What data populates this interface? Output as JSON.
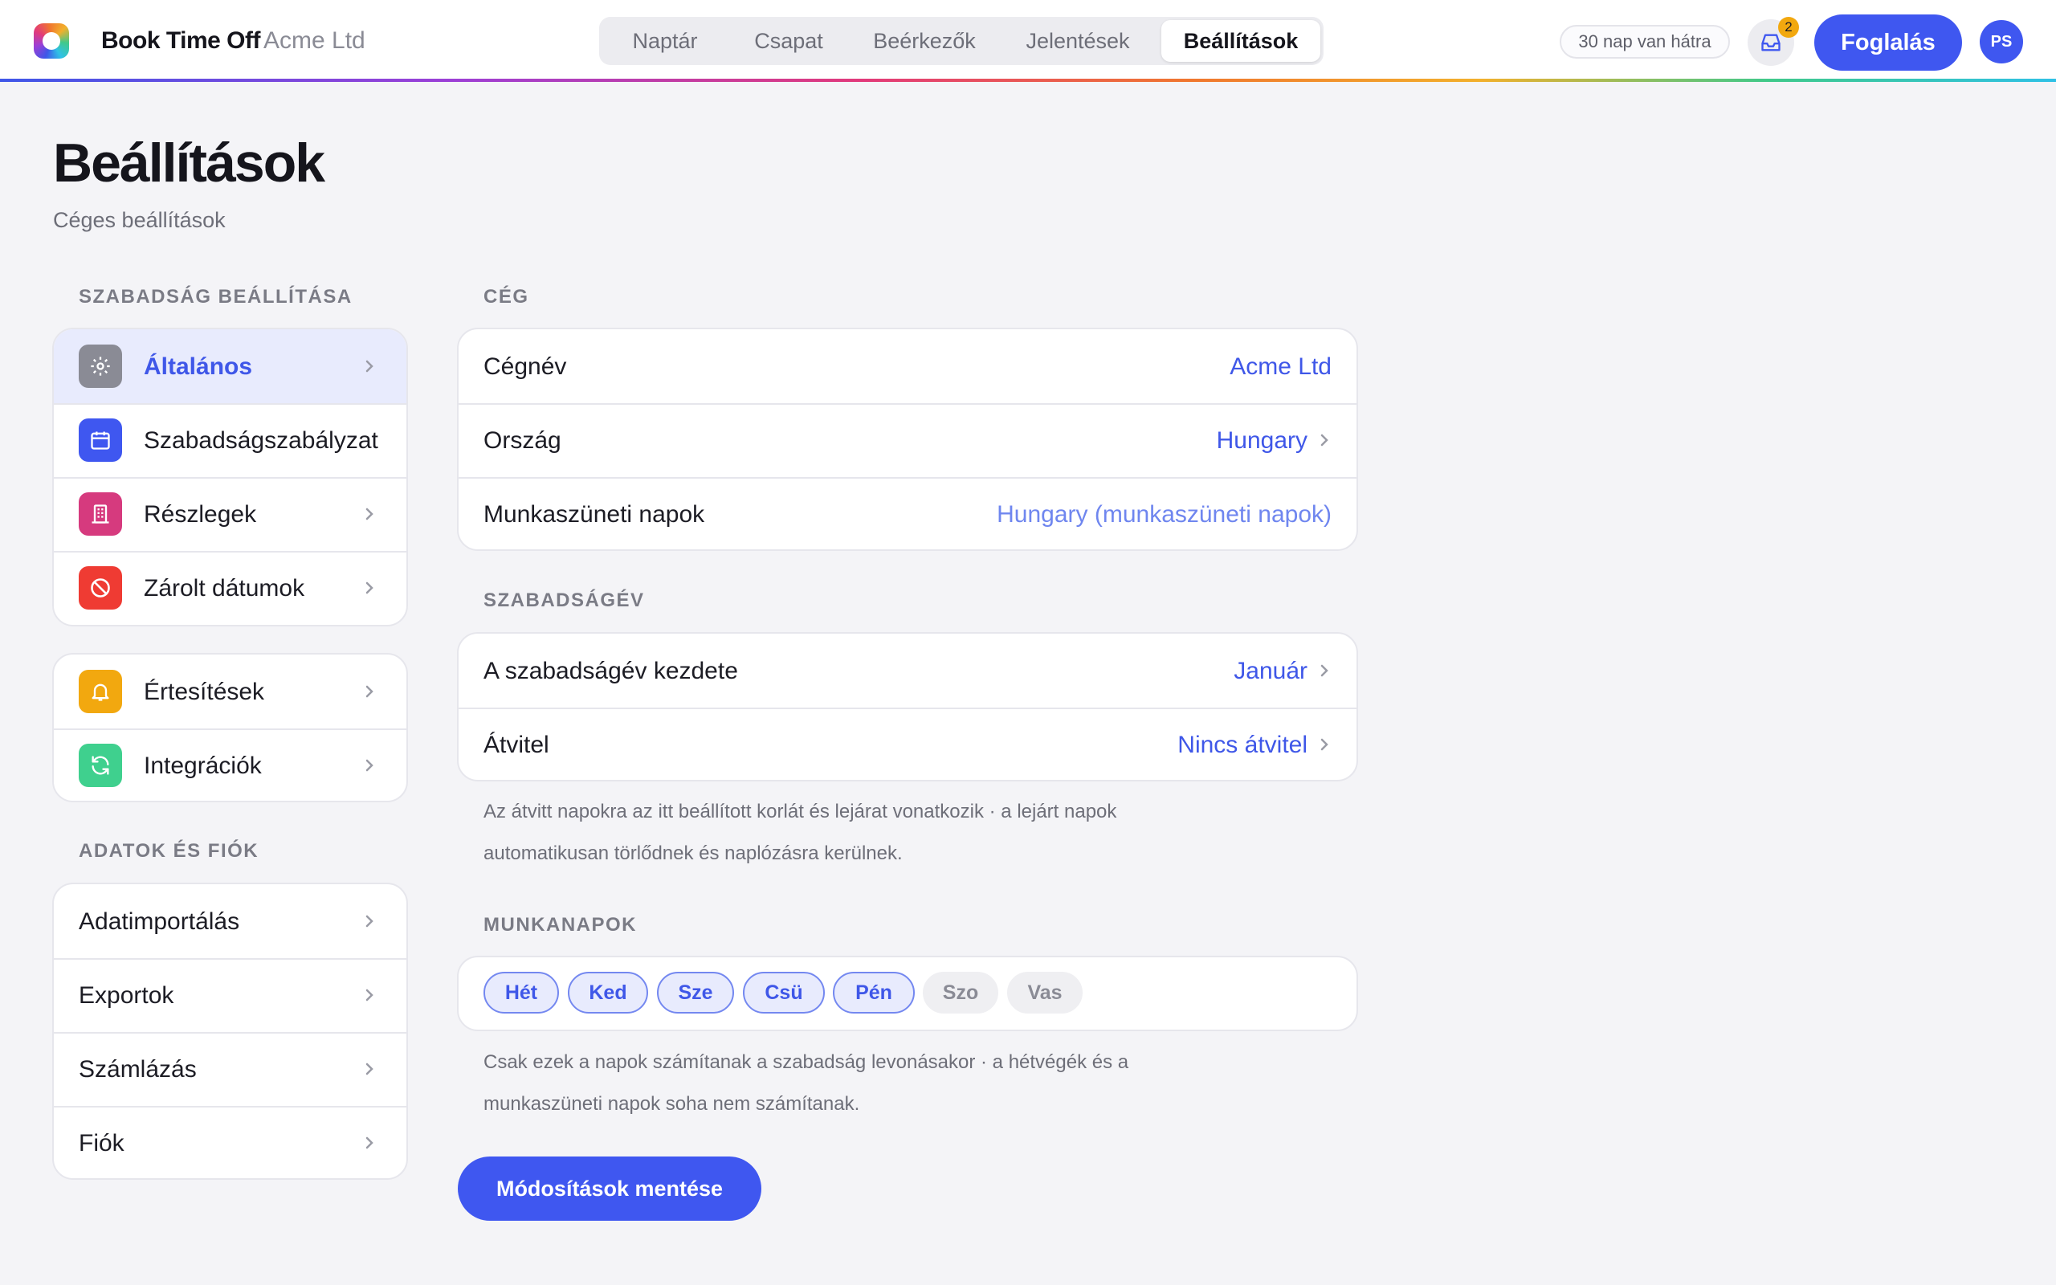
{
  "app": {
    "brand_name": "Book Time Off",
    "org_name": "Acme Ltd"
  },
  "nav": {
    "tabs": [
      {
        "label": "Naptár",
        "active": false
      },
      {
        "label": "Csapat",
        "active": false
      },
      {
        "label": "Beérkezők",
        "active": false
      },
      {
        "label": "Jelentések",
        "active": false
      },
      {
        "label": "Beállítások",
        "active": true
      }
    ]
  },
  "header": {
    "trial_text": "30 nap van hátra",
    "inbox_count": "2",
    "book_label": "Foglalás",
    "avatar_initials": "PS"
  },
  "page": {
    "title": "Beállítások",
    "subtitle": "Céges beállítások"
  },
  "sidebar": {
    "section1_label": "SZABADSÁG BEÁLLÍTÁSA",
    "group1": [
      {
        "label": "Általános",
        "icon": "gear-icon",
        "color": "#8a8b95",
        "active": true
      },
      {
        "label": "Szabadságszabályzat",
        "icon": "calendar-icon",
        "color": "#3f57f0",
        "active": false
      },
      {
        "label": "Részlegek",
        "icon": "building-icon",
        "color": "#d63a7e",
        "active": false
      },
      {
        "label": "Zárolt dátumok",
        "icon": "blocked-icon",
        "color": "#ef3b33",
        "active": false
      }
    ],
    "group2": [
      {
        "label": "Értesítések",
        "icon": "bell-icon",
        "color": "#f2a80f"
      },
      {
        "label": "Integrációk",
        "icon": "sync-icon",
        "color": "#3fd08e"
      }
    ],
    "section2_label": "ADATOK ÉS FIÓK",
    "group3": [
      {
        "label": "Adatimportálás"
      },
      {
        "label": "Exportok"
      },
      {
        "label": "Számlázás"
      },
      {
        "label": "Fiók"
      }
    ]
  },
  "company": {
    "section_label": "CÉG",
    "rows": [
      {
        "label": "Cégnév",
        "value": "Acme Ltd"
      },
      {
        "label": "Ország",
        "value": "Hungary"
      },
      {
        "label": "Munkaszüneti napok",
        "value": "Hungary (munkaszüneti napok)"
      }
    ]
  },
  "leave_year": {
    "section_label": "SZABADSÁGÉV",
    "rows": [
      {
        "label": "A szabadságév kezdete",
        "value": "Január"
      },
      {
        "label": "Átvitel",
        "value": "Nincs átvitel"
      }
    ],
    "help_line1": "Az átvitt napokra az itt beállított korlát és lejárat vonatkozik · a lejárt napok",
    "help_line2": "automatikusan törlődnek és naplózásra kerülnek."
  },
  "workdays": {
    "section_label": "MUNKANAPOK",
    "days": [
      {
        "label": "Hét",
        "on": true
      },
      {
        "label": "Ked",
        "on": true
      },
      {
        "label": "Sze",
        "on": true
      },
      {
        "label": "Csü",
        "on": true
      },
      {
        "label": "Pén",
        "on": true
      },
      {
        "label": "Szo",
        "on": false
      },
      {
        "label": "Vas",
        "on": false
      }
    ],
    "help_line1": "Csak ezek a napok számítanak a szabadság levonásakor · a hétvégék és a",
    "help_line2": "munkaszüneti napok soha nem számítanak."
  },
  "actions": {
    "save_label": "Módosítások mentése"
  },
  "colors": {
    "accent": "#3f57f0",
    "background": "#f4f4f7"
  }
}
